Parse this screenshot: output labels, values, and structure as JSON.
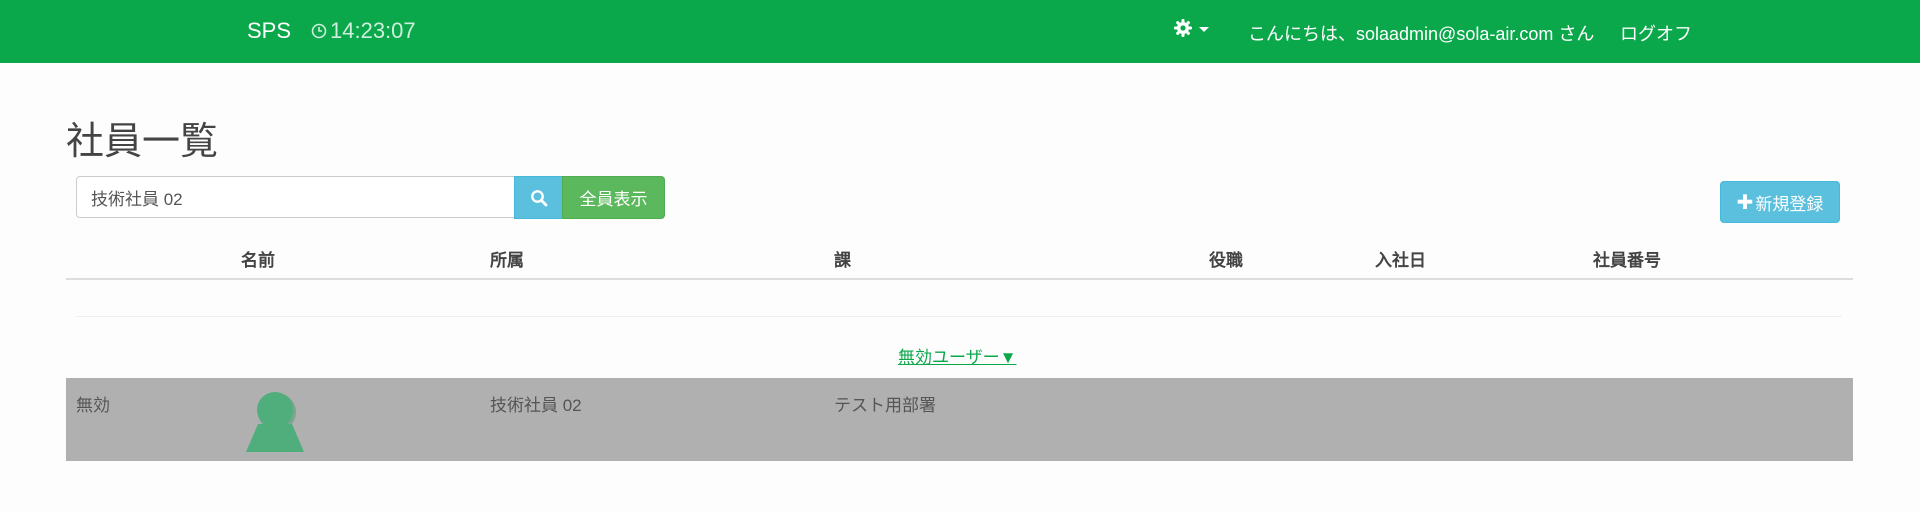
{
  "navbar": {
    "brand": "SPS",
    "clock": "14:23:07",
    "greeting": "こんにちは、solaadmin@sola-air.com さん",
    "logoff": "ログオフ",
    "icons": {
      "clock": "clock-icon",
      "settings": "gear-icon"
    }
  },
  "page": {
    "title": "社員一覧"
  },
  "search": {
    "value": "技術社員 02",
    "show_all_label": "全員表示",
    "new_label": "新規登録"
  },
  "table": {
    "headers": [
      "名前",
      "所属",
      "課",
      "役職",
      "入社日",
      "社員番号"
    ]
  },
  "disabled_toggle": "無効ユーザー▼",
  "disabled_rows": [
    {
      "status": "無効",
      "affiliation": "技術社員 02",
      "section": "テスト用部署"
    }
  ],
  "colors": {
    "navbar": "#0aa84a",
    "info_button": "#5bc0de",
    "success_button": "#5cb85c",
    "disabled_row": "#b0b0b0",
    "avatar": "#4fae7c"
  }
}
